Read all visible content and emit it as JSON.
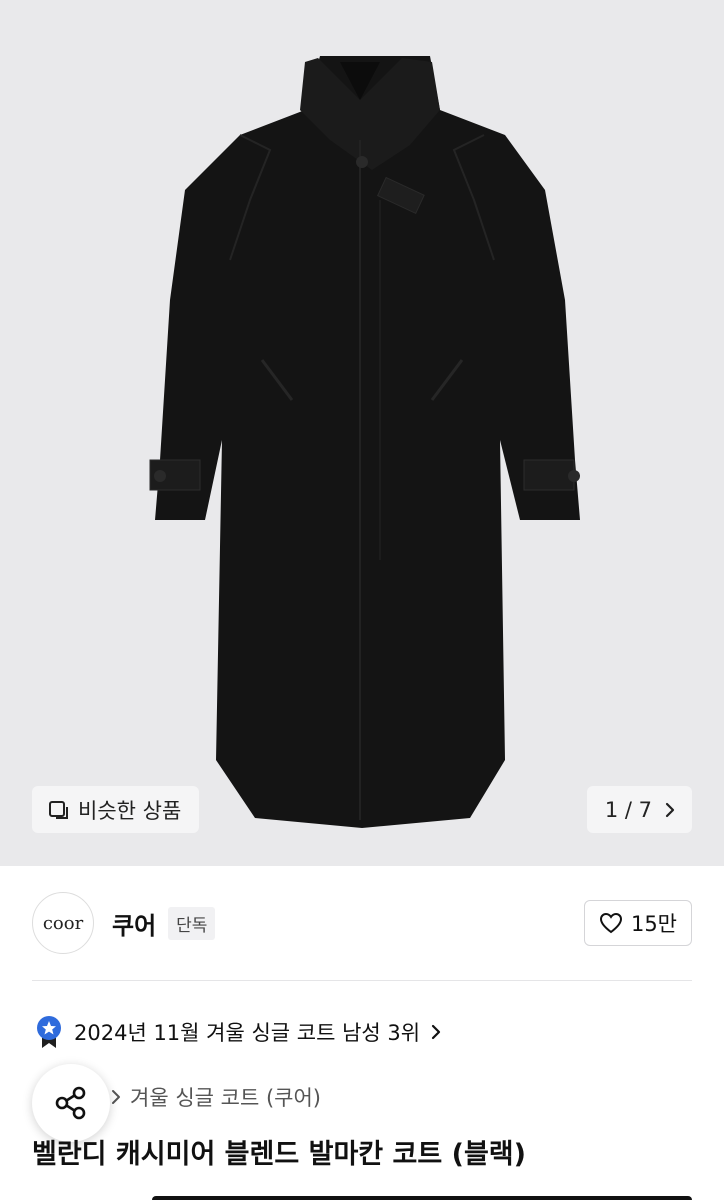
{
  "gallery": {
    "image_alt": "black long coat",
    "similar_label": "비슷한 상품",
    "counter": "1 / 7"
  },
  "brand": {
    "logo_text": "coor",
    "name": "쿠어",
    "badge": "단독",
    "likes": "15만"
  },
  "ranking": {
    "text": "2024년 11월 겨울 싱글 코트 남성 3위"
  },
  "category": {
    "text": "겨울 싱글 코트 (쿠어)"
  },
  "product": {
    "title": "벨란디 캐시미어 블렌드 발마칸 코트 (블랙)"
  },
  "colors": {
    "background": "#e9e9eb",
    "coat": "#141414",
    "badge_blue": "#2f6bdc"
  }
}
